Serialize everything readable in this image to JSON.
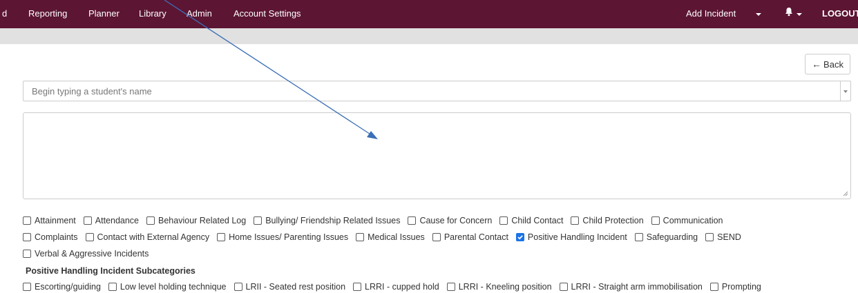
{
  "nav": {
    "left_items": [
      "d",
      "Reporting",
      "Planner",
      "Library",
      "Admin",
      "Account Settings"
    ],
    "add_incident": "Add Incident",
    "logout": "LOGOUT"
  },
  "back_button": {
    "label": "Back",
    "icon": "arrow-left-icon"
  },
  "student_select": {
    "placeholder": "Begin typing a student's name"
  },
  "notes_textarea": {
    "value": ""
  },
  "categories": [
    {
      "label": "Attainment",
      "checked": false
    },
    {
      "label": "Attendance",
      "checked": false
    },
    {
      "label": "Behaviour Related Log",
      "checked": false
    },
    {
      "label": "Bullying/ Friendship Related Issues",
      "checked": false
    },
    {
      "label": "Cause for Concern",
      "checked": false
    },
    {
      "label": "Child Contact",
      "checked": false
    },
    {
      "label": "Child Protection",
      "checked": false
    },
    {
      "label": "Communication",
      "checked": false
    },
    {
      "label": "Complaints",
      "checked": false
    },
    {
      "label": "Contact with External Agency",
      "checked": false
    },
    {
      "label": "Home Issues/ Parenting Issues",
      "checked": false
    },
    {
      "label": "Medical Issues",
      "checked": false
    },
    {
      "label": "Parental Contact",
      "checked": false
    },
    {
      "label": "Positive Handling Incident",
      "checked": true
    },
    {
      "label": "Safeguarding",
      "checked": false
    },
    {
      "label": "SEND",
      "checked": false
    },
    {
      "label": "Verbal & Aggressive Incidents",
      "checked": false
    }
  ],
  "subcategories_heading": "Positive Handling Incident Subcategories",
  "subcategories": [
    {
      "label": "Escorting/guiding",
      "checked": false
    },
    {
      "label": "Low level holding technique",
      "checked": false
    },
    {
      "label": "LRII - Seated rest position",
      "checked": false
    },
    {
      "label": "LRRI - cupped hold",
      "checked": false
    },
    {
      "label": "LRRI - Kneeling position",
      "checked": false
    },
    {
      "label": "LRRI - Straight arm immobilisation",
      "checked": false
    },
    {
      "label": "Prompting",
      "checked": false
    }
  ],
  "colors": {
    "navbar": "#5c1533",
    "subbar": "#e1e1e1",
    "checkbox_checked": "#1a73e8",
    "annotation_arrow": "#3b6fb6"
  }
}
